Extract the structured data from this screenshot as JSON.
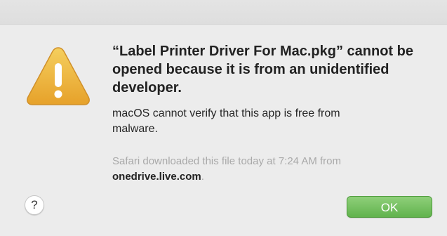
{
  "dialog": {
    "icon": "warning-icon",
    "headline": "“Label Printer Driver For Mac.pkg” cannot be opened because it is from an unidentified developer.",
    "message": "macOS cannot verify that this app is free from malware.",
    "source_prefix": "Safari downloaded this file today at 7:24 AM from",
    "source_domain": "onedrive.live.com",
    "source_suffix": ".",
    "help_label": "?",
    "ok_label": "OK"
  },
  "colors": {
    "background": "#ececec",
    "ok_button": "#61b34d",
    "warning_icon": "#f0b63c",
    "secondary_text": "#a9a9a9"
  }
}
